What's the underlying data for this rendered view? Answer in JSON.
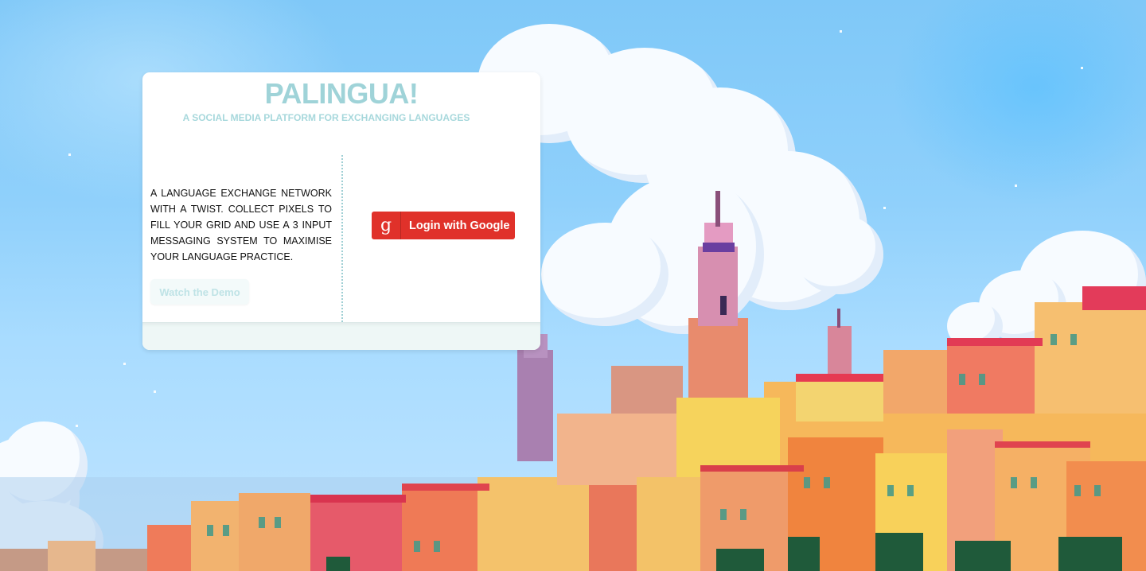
{
  "brand": {
    "title": "PALINGUA!",
    "subtitle": "A SOCIAL MEDIA PLATFORM FOR EXCHANGING LANGUAGES"
  },
  "intro": {
    "description": "A LANGUAGE EXCHANGE NETWORK WITH A TWIST. COLLECT PIXELS TO FILL YOUR GRID AND USE A 3 INPUT MESSAGING SYSTEM TO MAXIMISE YOUR LANGUAGE PRACTICE.",
    "demo_label": "Watch the Demo"
  },
  "auth": {
    "google_label": "Login with Google",
    "google_icon": "g",
    "google_color": "#e0312a"
  },
  "icons": {
    "google": "google-g-icon"
  },
  "colors": {
    "accent": "#9fd3d8",
    "sky": "#8fd0fb"
  }
}
